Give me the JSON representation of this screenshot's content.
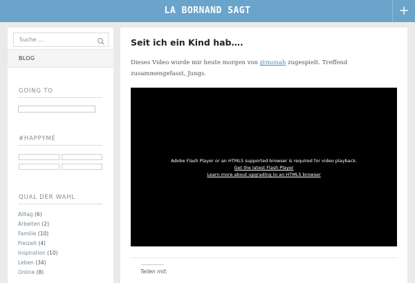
{
  "header": {
    "site_title": "LA BORNAND SAGT",
    "menu_toggle": "+"
  },
  "sidebar": {
    "search": {
      "placeholder": "Suche ..."
    },
    "nav": {
      "blog_label": "BLOG"
    },
    "going_to": {
      "title": "GOING TO"
    },
    "happyme": {
      "title": "#HAPPYME"
    },
    "categories": {
      "title": "QUAL DER WAHL",
      "items": [
        {
          "name": "Alltag",
          "count": "(6)"
        },
        {
          "name": "Arbeiten",
          "count": "(2)"
        },
        {
          "name": "Familie",
          "count": "(10)"
        },
        {
          "name": "Freizeit",
          "count": "(4)"
        },
        {
          "name": "Inspiration",
          "count": "(10)"
        },
        {
          "name": "Leben",
          "count": "(34)"
        },
        {
          "name": "Online",
          "count": "(8)"
        }
      ]
    }
  },
  "post": {
    "title": "Seit ich ein Kind hab….",
    "text_before": "Dieses Video wurde mir heute morgen von ",
    "mention": "@monah",
    "text_after": " zugespielt. Treffend zusammengefasst, Jungs.",
    "video": {
      "message": "Adobe Flash Player or an HTML5 supported browser is required for video playback.",
      "link1": "Get the latest Flash Player",
      "link2": "Learn more about upgrading to an HTML5 browser"
    },
    "share_label": "Teilen mit:"
  }
}
